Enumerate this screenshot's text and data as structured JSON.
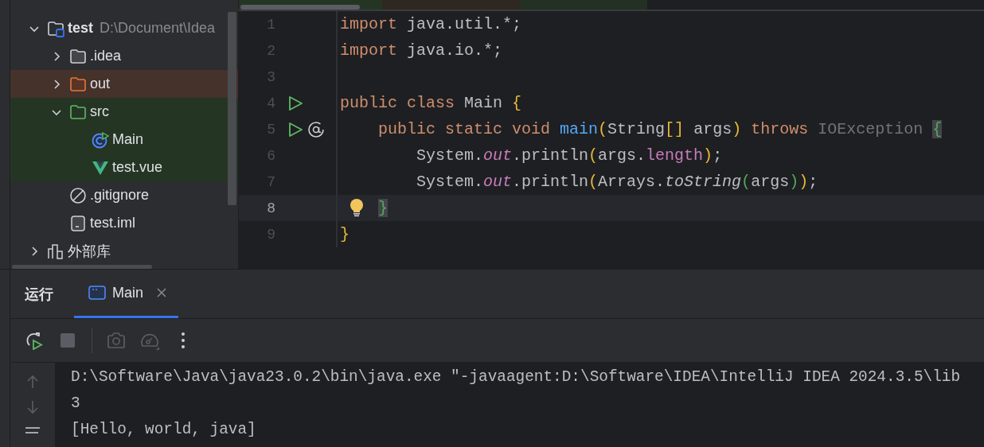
{
  "project_tree": [
    {
      "label": "test",
      "path": "D:\\Document\\Idea",
      "kind": "project",
      "expanded": true,
      "children": [
        {
          "label": ".idea",
          "kind": "folder",
          "expanded": false
        },
        {
          "label": "out",
          "kind": "excluded",
          "expanded": false
        },
        {
          "label": "src",
          "kind": "source",
          "expanded": true,
          "children": [
            {
              "label": "Main",
              "kind": "class"
            },
            {
              "label": "test.vue",
              "kind": "vue"
            }
          ]
        },
        {
          "label": ".gitignore",
          "kind": "ignore"
        },
        {
          "label": "test.iml",
          "kind": "iml"
        }
      ]
    },
    {
      "label": "外部库",
      "kind": "library",
      "expanded": false
    }
  ],
  "editor": {
    "lines": [
      {
        "number": "1",
        "current": false,
        "tokens": [
          {
            "kind": "keyword",
            "text": "import"
          },
          {
            "kind": "plain",
            "text": " java.util.*;"
          }
        ]
      },
      {
        "number": "2",
        "current": false,
        "tokens": [
          {
            "kind": "keyword",
            "text": "import"
          },
          {
            "kind": "plain",
            "text": " java.io.*;"
          }
        ]
      },
      {
        "number": "3",
        "current": false
      },
      {
        "number": "4",
        "current": false,
        "markers": [
          {
            "kind": "run"
          }
        ],
        "tokens": [
          {
            "kind": "keyword",
            "text": "public class"
          },
          {
            "kind": "plain",
            "text": " Main "
          },
          {
            "kind": "brace1",
            "text": "{"
          }
        ]
      },
      {
        "number": "5",
        "current": false,
        "markers": [
          {
            "kind": "run"
          },
          {
            "kind": "override"
          }
        ],
        "tokens": [
          {
            "kind": "keyword",
            "text": "    public static void "
          },
          {
            "kind": "method",
            "text": "main"
          },
          {
            "kind": "brace1",
            "text": "("
          },
          {
            "kind": "plain",
            "text": "String"
          },
          {
            "kind": "brace1",
            "text": "[]"
          },
          {
            "kind": "plain",
            "text": " args"
          },
          {
            "kind": "brace1",
            "text": ")"
          },
          {
            "kind": "keyword",
            "text": " throws"
          },
          {
            "kind": "unused",
            "text": " IOException "
          },
          {
            "kind": "match",
            "text": "{"
          }
        ]
      },
      {
        "number": "6",
        "current": false,
        "tokens": [
          {
            "kind": "plain",
            "text": "        System."
          },
          {
            "kind": "static-field",
            "text": "out"
          },
          {
            "kind": "plain",
            "text": ".println"
          },
          {
            "kind": "brace1",
            "text": "("
          },
          {
            "kind": "plain",
            "text": "args."
          },
          {
            "kind": "field",
            "text": "length"
          },
          {
            "kind": "brace1",
            "text": ")"
          },
          {
            "kind": "plain",
            "text": ";"
          }
        ]
      },
      {
        "number": "7",
        "current": false,
        "tokens": [
          {
            "kind": "plain",
            "text": "        System."
          },
          {
            "kind": "static-field",
            "text": "out"
          },
          {
            "kind": "plain",
            "text": ".println"
          },
          {
            "kind": "brace1",
            "text": "("
          },
          {
            "kind": "plain",
            "text": "Arrays."
          },
          {
            "kind": "static-method",
            "text": "toString"
          },
          {
            "kind": "brace2",
            "text": "("
          },
          {
            "kind": "plain",
            "text": "args"
          },
          {
            "kind": "brace2",
            "text": ")"
          },
          {
            "kind": "brace1",
            "text": ")"
          },
          {
            "kind": "plain",
            "text": ";"
          }
        ]
      },
      {
        "number": "8",
        "current": true,
        "markers": [
          {
            "kind": "bulb"
          }
        ],
        "tokens": [
          {
            "kind": "match",
            "text": "    }"
          }
        ]
      },
      {
        "number": "9",
        "current": false,
        "tokens": [
          {
            "kind": "brace1",
            "text": "}"
          }
        ]
      }
    ]
  },
  "run_panel": {
    "title": "运行",
    "tabs": [
      {
        "label": "Main",
        "selected": true
      }
    ],
    "toolbar": [
      {
        "kind": "rerun",
        "disabled": false
      },
      {
        "kind": "stop",
        "disabled": true
      },
      {
        "kind": "separator"
      },
      {
        "kind": "camera",
        "disabled": true
      },
      {
        "kind": "gauge",
        "disabled": true
      },
      {
        "kind": "more",
        "disabled": false
      }
    ],
    "console": [
      "D:\\Software\\Java\\java23.0.2\\bin\\java.exe \"-javaagent:D:\\Software\\IDEA\\IntelliJ IDEA 2024.3.5\\lib",
      "3",
      "[Hello, world, java]"
    ]
  }
}
